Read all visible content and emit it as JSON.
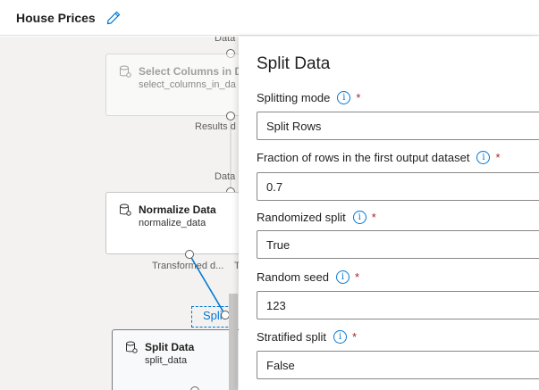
{
  "header": {
    "title": "House Prices"
  },
  "canvas": {
    "nodes": {
      "select_columns": {
        "title": "Select Columns in D",
        "subtitle": "select_columns_in_da"
      },
      "normalize": {
        "title": "Normalize Data",
        "subtitle": "normalize_data"
      },
      "split": {
        "title": "Split Data",
        "subtitle": "split_data"
      }
    },
    "port_labels": {
      "data_top": "Data",
      "results": "Results d",
      "data_mid": "Data",
      "transformed": "Transformed d...",
      "transformed_extra": "T"
    },
    "drop_target": "Split"
  },
  "panel": {
    "title": "Split Data",
    "fields": [
      {
        "label": "Splitting mode",
        "value": "Split Rows"
      },
      {
        "label": "Fraction of rows in the first output dataset",
        "value": "0.7"
      },
      {
        "label": "Randomized split",
        "value": "True"
      },
      {
        "label": "Random seed",
        "value": "123"
      },
      {
        "label": "Stratified split",
        "value": "False"
      }
    ],
    "info_glyph": "i",
    "required_marker": "*"
  },
  "colors": {
    "accent": "#0078d4",
    "required": "#a4262c",
    "connector": "#0078d4"
  }
}
